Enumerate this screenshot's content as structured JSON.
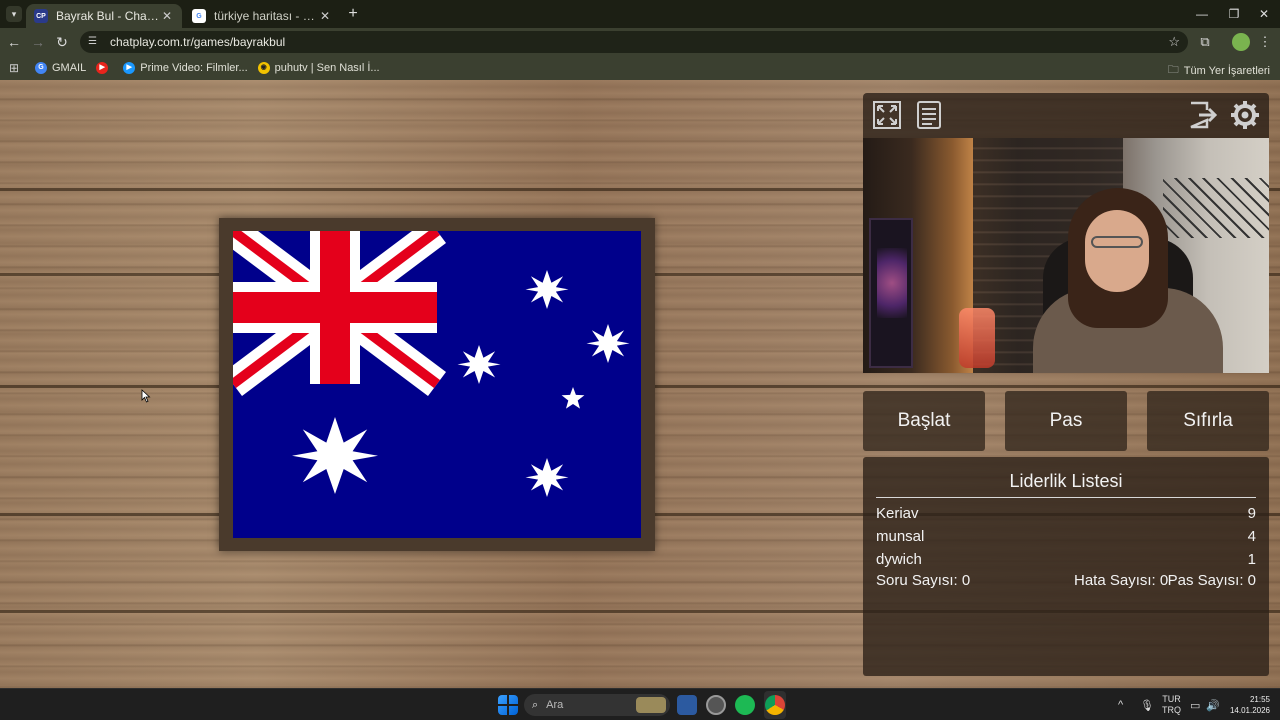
{
  "browser": {
    "tabs": [
      {
        "title": "Bayrak Bul - ChatPlay",
        "favicon": "CP",
        "active": true
      },
      {
        "title": "türkiye haritası - Google'da Ara",
        "favicon": "G",
        "active": false
      }
    ],
    "url": "chatplay.com.tr/games/bayrakbul",
    "bookmarks": [
      {
        "label": "GMAIL",
        "icon": "google-icon",
        "color": "#4285f4"
      },
      {
        "label": "",
        "icon": "youtube-icon",
        "color": "#ff0000"
      },
      {
        "label": "Prime Video: Filmler...",
        "icon": "prime-video-icon",
        "color": "#1a98ff"
      },
      {
        "label": "puhutv | Sen Nasıl İ...",
        "icon": "puhutv-icon",
        "color": "#f2c200"
      }
    ],
    "all_bookmarks_label": "Tüm Yer İşaretleri"
  },
  "game": {
    "flag_country": "australia",
    "buttons": {
      "start": "Başlat",
      "pass": "Pas",
      "reset": "Sıfırla"
    },
    "leaderboard": {
      "title": "Liderlik Listesi",
      "rows": [
        {
          "name": "Keriav",
          "score": "9"
        },
        {
          "name": "munsal",
          "score": "4"
        },
        {
          "name": "dywich",
          "score": "1"
        }
      ],
      "stats": {
        "questions": "Soru Sayısı: 0",
        "errors": "Hata Sayısı: 0",
        "passes": "Pas Sayısı: 0"
      }
    },
    "controls": [
      "fullscreen-icon",
      "notes-icon",
      "exit-icon",
      "gear-icon"
    ]
  },
  "taskbar": {
    "search_placeholder": "Ara",
    "language_top": "TUR",
    "language_bottom": "TRQ",
    "time": "21:55",
    "date": "14.01.2026"
  }
}
